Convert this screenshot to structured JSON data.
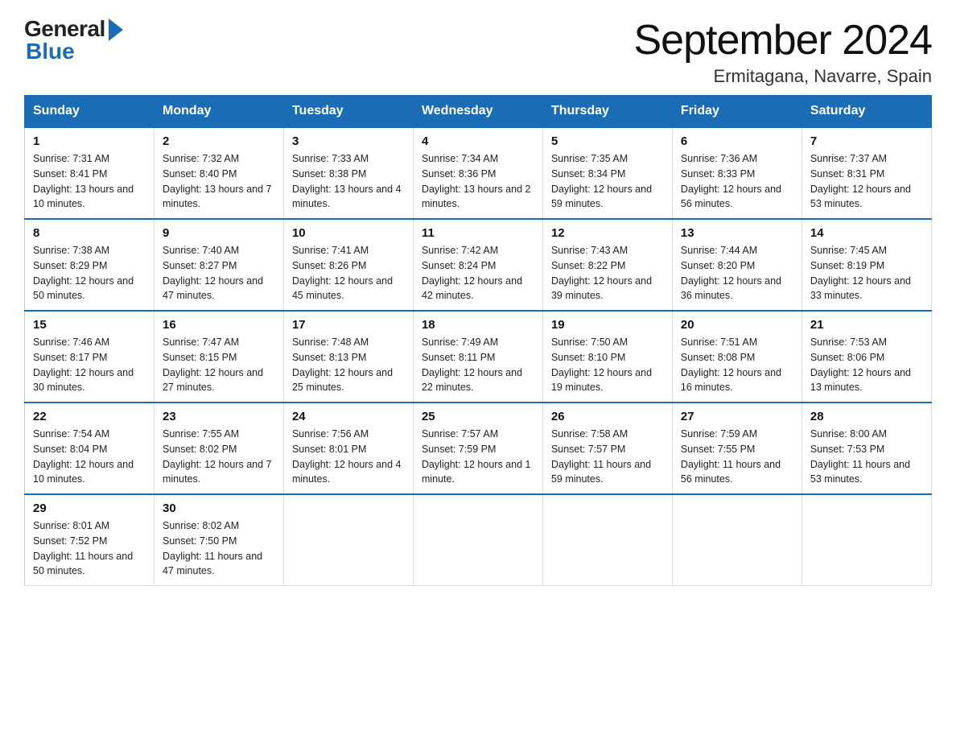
{
  "header": {
    "logo_general": "General",
    "logo_blue": "Blue",
    "title": "September 2024",
    "subtitle": "Ermitagana, Navarre, Spain"
  },
  "calendar": {
    "days_of_week": [
      "Sunday",
      "Monday",
      "Tuesday",
      "Wednesday",
      "Thursday",
      "Friday",
      "Saturday"
    ],
    "weeks": [
      [
        {
          "day": "1",
          "sunrise": "7:31 AM",
          "sunset": "8:41 PM",
          "daylight": "13 hours and 10 minutes."
        },
        {
          "day": "2",
          "sunrise": "7:32 AM",
          "sunset": "8:40 PM",
          "daylight": "13 hours and 7 minutes."
        },
        {
          "day": "3",
          "sunrise": "7:33 AM",
          "sunset": "8:38 PM",
          "daylight": "13 hours and 4 minutes."
        },
        {
          "day": "4",
          "sunrise": "7:34 AM",
          "sunset": "8:36 PM",
          "daylight": "13 hours and 2 minutes."
        },
        {
          "day": "5",
          "sunrise": "7:35 AM",
          "sunset": "8:34 PM",
          "daylight": "12 hours and 59 minutes."
        },
        {
          "day": "6",
          "sunrise": "7:36 AM",
          "sunset": "8:33 PM",
          "daylight": "12 hours and 56 minutes."
        },
        {
          "day": "7",
          "sunrise": "7:37 AM",
          "sunset": "8:31 PM",
          "daylight": "12 hours and 53 minutes."
        }
      ],
      [
        {
          "day": "8",
          "sunrise": "7:38 AM",
          "sunset": "8:29 PM",
          "daylight": "12 hours and 50 minutes."
        },
        {
          "day": "9",
          "sunrise": "7:40 AM",
          "sunset": "8:27 PM",
          "daylight": "12 hours and 47 minutes."
        },
        {
          "day": "10",
          "sunrise": "7:41 AM",
          "sunset": "8:26 PM",
          "daylight": "12 hours and 45 minutes."
        },
        {
          "day": "11",
          "sunrise": "7:42 AM",
          "sunset": "8:24 PM",
          "daylight": "12 hours and 42 minutes."
        },
        {
          "day": "12",
          "sunrise": "7:43 AM",
          "sunset": "8:22 PM",
          "daylight": "12 hours and 39 minutes."
        },
        {
          "day": "13",
          "sunrise": "7:44 AM",
          "sunset": "8:20 PM",
          "daylight": "12 hours and 36 minutes."
        },
        {
          "day": "14",
          "sunrise": "7:45 AM",
          "sunset": "8:19 PM",
          "daylight": "12 hours and 33 minutes."
        }
      ],
      [
        {
          "day": "15",
          "sunrise": "7:46 AM",
          "sunset": "8:17 PM",
          "daylight": "12 hours and 30 minutes."
        },
        {
          "day": "16",
          "sunrise": "7:47 AM",
          "sunset": "8:15 PM",
          "daylight": "12 hours and 27 minutes."
        },
        {
          "day": "17",
          "sunrise": "7:48 AM",
          "sunset": "8:13 PM",
          "daylight": "12 hours and 25 minutes."
        },
        {
          "day": "18",
          "sunrise": "7:49 AM",
          "sunset": "8:11 PM",
          "daylight": "12 hours and 22 minutes."
        },
        {
          "day": "19",
          "sunrise": "7:50 AM",
          "sunset": "8:10 PM",
          "daylight": "12 hours and 19 minutes."
        },
        {
          "day": "20",
          "sunrise": "7:51 AM",
          "sunset": "8:08 PM",
          "daylight": "12 hours and 16 minutes."
        },
        {
          "day": "21",
          "sunrise": "7:53 AM",
          "sunset": "8:06 PM",
          "daylight": "12 hours and 13 minutes."
        }
      ],
      [
        {
          "day": "22",
          "sunrise": "7:54 AM",
          "sunset": "8:04 PM",
          "daylight": "12 hours and 10 minutes."
        },
        {
          "day": "23",
          "sunrise": "7:55 AM",
          "sunset": "8:02 PM",
          "daylight": "12 hours and 7 minutes."
        },
        {
          "day": "24",
          "sunrise": "7:56 AM",
          "sunset": "8:01 PM",
          "daylight": "12 hours and 4 minutes."
        },
        {
          "day": "25",
          "sunrise": "7:57 AM",
          "sunset": "7:59 PM",
          "daylight": "12 hours and 1 minute."
        },
        {
          "day": "26",
          "sunrise": "7:58 AM",
          "sunset": "7:57 PM",
          "daylight": "11 hours and 59 minutes."
        },
        {
          "day": "27",
          "sunrise": "7:59 AM",
          "sunset": "7:55 PM",
          "daylight": "11 hours and 56 minutes."
        },
        {
          "day": "28",
          "sunrise": "8:00 AM",
          "sunset": "7:53 PM",
          "daylight": "11 hours and 53 minutes."
        }
      ],
      [
        {
          "day": "29",
          "sunrise": "8:01 AM",
          "sunset": "7:52 PM",
          "daylight": "11 hours and 50 minutes."
        },
        {
          "day": "30",
          "sunrise": "8:02 AM",
          "sunset": "7:50 PM",
          "daylight": "11 hours and 47 minutes."
        },
        null,
        null,
        null,
        null,
        null
      ]
    ]
  }
}
